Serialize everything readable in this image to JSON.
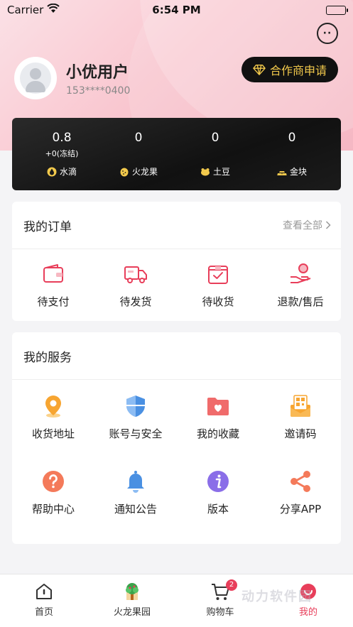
{
  "status_bar": {
    "carrier": "Carrier",
    "time": "6:54 PM"
  },
  "profile": {
    "name": "小优用户",
    "phone": "153****0400",
    "partner_button": "合作商申请"
  },
  "assets": [
    {
      "value": "0.8",
      "sub": "+0(冻结)",
      "label": "水滴",
      "icon": "water-drop-icon"
    },
    {
      "value": "0",
      "sub": "",
      "label": "火龙果",
      "icon": "dragon-fruit-icon"
    },
    {
      "value": "0",
      "sub": "",
      "label": "土豆",
      "icon": "potato-icon"
    },
    {
      "value": "0",
      "sub": "",
      "label": "金块",
      "icon": "gold-bar-icon"
    }
  ],
  "orders": {
    "title": "我的订单",
    "more": "查看全部",
    "items": [
      {
        "label": "待支付",
        "icon": "wallet-icon"
      },
      {
        "label": "待发货",
        "icon": "truck-icon"
      },
      {
        "label": "待收货",
        "icon": "box-check-icon"
      },
      {
        "label": "退款/售后",
        "icon": "refund-icon"
      }
    ]
  },
  "services": {
    "title": "我的服务",
    "items": [
      {
        "label": "收货地址",
        "icon": "location-pin-icon"
      },
      {
        "label": "账号与安全",
        "icon": "shield-icon"
      },
      {
        "label": "我的收藏",
        "icon": "favorite-folder-icon"
      },
      {
        "label": "邀请码",
        "icon": "qr-code-icon"
      },
      {
        "label": "帮助中心",
        "icon": "help-icon"
      },
      {
        "label": "通知公告",
        "icon": "bell-icon"
      },
      {
        "label": "版本",
        "icon": "info-icon"
      },
      {
        "label": "分享APP",
        "icon": "share-icon"
      }
    ]
  },
  "tabbar": {
    "items": [
      {
        "label": "首页",
        "icon": "home-icon"
      },
      {
        "label": "火龙果园",
        "icon": "orchard-icon"
      },
      {
        "label": "购物车",
        "icon": "cart-icon",
        "badge": "2"
      },
      {
        "label": "我的",
        "icon": "profile-icon",
        "active": true
      }
    ]
  },
  "watermark": "动力软件园",
  "colors": {
    "accent": "#e83e5a",
    "gold": "#f2c94c",
    "dark_card": "#111111"
  }
}
